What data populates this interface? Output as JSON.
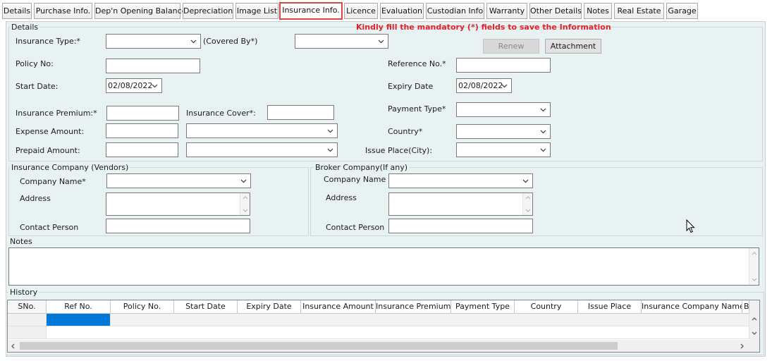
{
  "tabs": [
    {
      "label": "Details"
    },
    {
      "label": "Purchase Info."
    },
    {
      "label": "Dep'n Opening Balance"
    },
    {
      "label": "Depreciation"
    },
    {
      "label": "Image List"
    },
    {
      "label": "Insurance Info."
    },
    {
      "label": "Licence"
    },
    {
      "label": "Evaluation"
    },
    {
      "label": "Custodian Info"
    },
    {
      "label": "Warranty"
    },
    {
      "label": "Other Details"
    },
    {
      "label": "Notes"
    },
    {
      "label": "Real Estate"
    },
    {
      "label": "Garage"
    }
  ],
  "active_tab": "Insurance Info.",
  "details": {
    "title": "Details",
    "mandatory_message": "Kindly fill the mandatory (*) fields to save the Information",
    "insurance_type_label": "Insurance Type:*",
    "covered_by_label": "(Covered By*)",
    "renew_label": "Renew",
    "attachment_label": "Attachment",
    "policy_no_label": "Policy No:",
    "reference_no_label": "Reference No.*",
    "start_date_label": "Start Date:",
    "start_date_value": "02/08/2022",
    "expiry_date_label": "Expiry Date",
    "expiry_date_value": "02/08/2022",
    "insurance_premium_label": "Insurance Premium:*",
    "insurance_cover_label": "Insurance Cover*:",
    "payment_type_label": "Payment Type*",
    "expense_amount_label": "Expense Amount:",
    "country_label": "Country*",
    "prepaid_amount_label": "Prepaid Amount:",
    "issue_place_label": "Issue Place(City):"
  },
  "insurance_company": {
    "title": "Insurance Company (Vendors)",
    "company_name_label": "Company Name*",
    "address_label": "Address",
    "contact_person_label": "Contact Person"
  },
  "broker_company": {
    "title": "Broker Company(If any)",
    "company_name_label": "Company Name",
    "address_label": "Address",
    "contact_person_label": "Contact Person"
  },
  "notes": {
    "title": "Notes"
  },
  "history": {
    "title": "History",
    "columns": [
      "SNo.",
      "Ref No.",
      "Policy No.",
      "Start Date",
      "Expiry Date",
      "Insurance Amount",
      "Insurance Premium",
      "Payment Type",
      "Country",
      "Issue Place",
      "Insurance Company Name",
      "B"
    ]
  },
  "colors": {
    "accent_red": "#e0202a",
    "panel_bg": "#e9f2f3",
    "selected_cell": "#0078d7"
  }
}
